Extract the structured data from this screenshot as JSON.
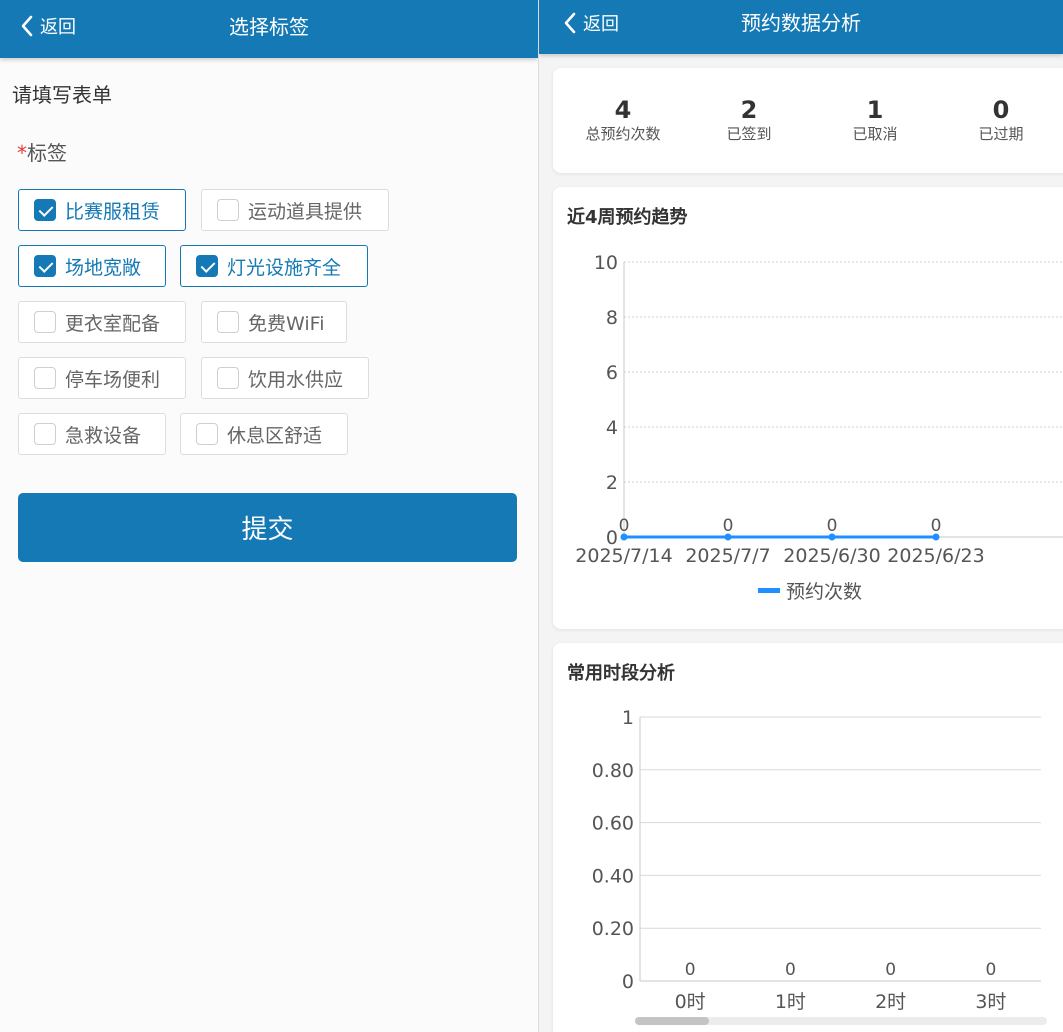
{
  "left": {
    "nav": {
      "back_label": "返回",
      "title": "选择标签"
    },
    "form_heading": "请填写表单",
    "tag_field": {
      "required_mark": "*",
      "label": "标签"
    },
    "tags": [
      {
        "label": "比赛服租赁",
        "checked": true
      },
      {
        "label": "运动道具提供",
        "checked": false
      },
      {
        "label": "场地宽敞",
        "checked": true
      },
      {
        "label": "灯光设施齐全",
        "checked": true
      },
      {
        "label": "更衣室配备",
        "checked": false
      },
      {
        "label": "免费WiFi",
        "checked": false
      },
      {
        "label": "停车场便利",
        "checked": false
      },
      {
        "label": "饮用水供应",
        "checked": false
      },
      {
        "label": "急救设备",
        "checked": false
      },
      {
        "label": "休息区舒适",
        "checked": false
      }
    ],
    "submit_label": "提交"
  },
  "right": {
    "nav": {
      "back_label": "返回",
      "title": "预约数据分析"
    },
    "stats": [
      {
        "value": "4",
        "label": "总预约次数"
      },
      {
        "value": "2",
        "label": "已签到"
      },
      {
        "value": "1",
        "label": "已取消"
      },
      {
        "value": "0",
        "label": "已过期"
      }
    ],
    "trend_card_title": "近4周预约趋势",
    "hours_card_title": "常用时段分析"
  },
  "colors": {
    "primary": "#1479b5",
    "line_series": "#1e90ff",
    "required": "#e53935"
  },
  "chart_data": [
    {
      "type": "line",
      "x": [
        "2025/7/14",
        "2025/7/7",
        "2025/6/30",
        "2025/6/23"
      ],
      "series": [
        {
          "name": "预约次数",
          "values": [
            0,
            0,
            0,
            0
          ]
        }
      ],
      "data_labels": [
        "0",
        "0",
        "0",
        "0"
      ],
      "yticks": [
        "0",
        "2",
        "4",
        "6",
        "8",
        "10"
      ],
      "ylim": [
        0,
        10
      ],
      "grid": "dotted horizontal",
      "legend": "bottom-center"
    },
    {
      "type": "bar",
      "categories": [
        "0时",
        "1时",
        "2时",
        "3时"
      ],
      "values": [
        0,
        0,
        0,
        0
      ],
      "data_labels": [
        "0",
        "0",
        "0",
        "0"
      ],
      "yticks": [
        "0",
        "0.20",
        "0.40",
        "0.60",
        "0.80",
        "1"
      ],
      "ylim": [
        0,
        1
      ],
      "grid": "solid horizontal",
      "scrollable": true,
      "scroll_fraction": 0.18
    }
  ]
}
